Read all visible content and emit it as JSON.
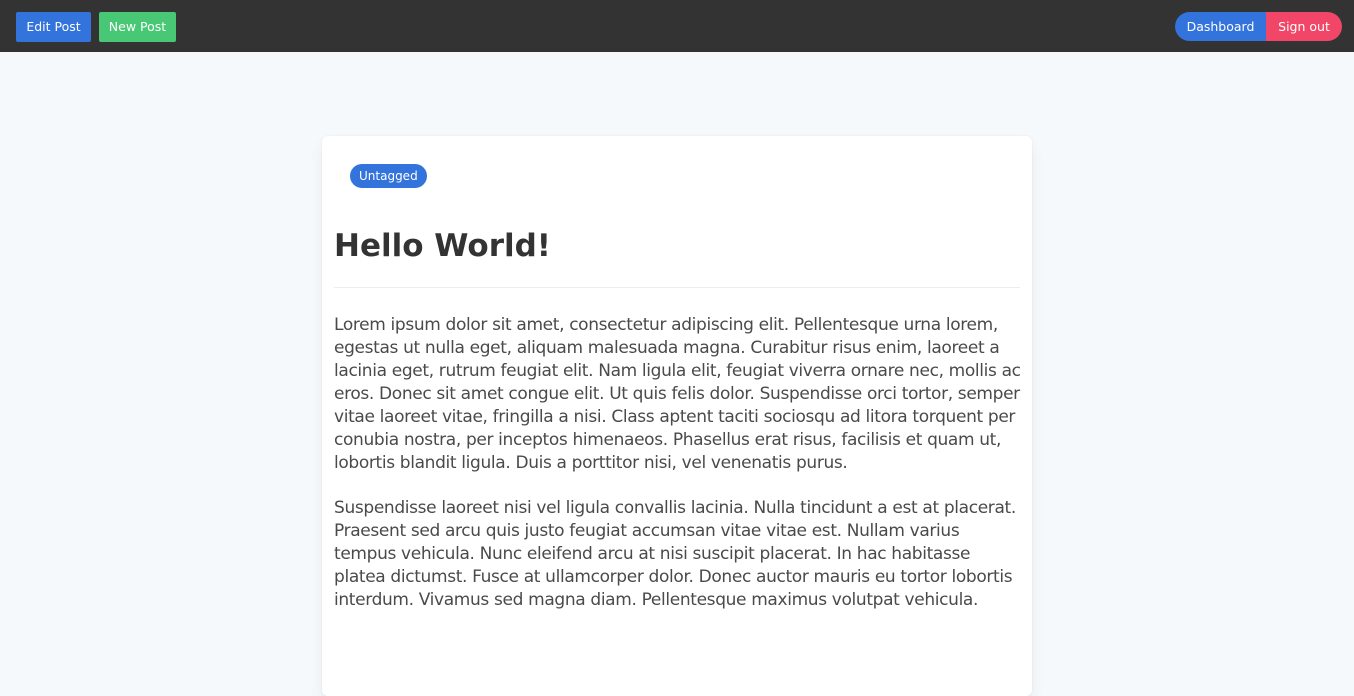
{
  "toolbar": {
    "edit_label": "Edit Post",
    "new_label": "New Post",
    "dashboard_label": "Dashboard",
    "signout_label": "Sign out"
  },
  "post": {
    "tag": "Untagged",
    "title": "Hello World!",
    "paragraphs": [
      "Lorem ipsum dolor sit amet, consectetur adipiscing elit. Pellentesque urna lorem, egestas ut nulla eget, aliquam malesuada magna. Curabitur risus enim, laoreet a lacinia eget, rutrum feugiat elit. Nam ligula elit, feugiat viverra ornare nec, mollis ac eros. Donec sit amet congue elit. Ut quis felis dolor. Suspendisse orci tortor, semper vitae laoreet vitae, fringilla a nisi. Class aptent taciti sociosqu ad litora torquent per conubia nostra, per inceptos himenaeos. Phasellus erat risus, facilisis et quam ut, lobortis blandit ligula. Duis a porttitor nisi, vel venenatis purus.",
      "Suspendisse laoreet nisi vel ligula convallis lacinia. Nulla tincidunt a est at placerat. Praesent sed arcu quis justo feugiat accumsan vitae vitae est. Nullam varius tempus vehicula. Nunc eleifend arcu at nisi suscipit placerat. In hac habitasse platea dictumst. Fusce at ullamcorper dolor. Donec auctor mauris eu tortor lobortis interdum. Vivamus sed magna diam. Pellentesque maximus volutpat vehicula."
    ]
  },
  "colors": {
    "primary": "#3273dc",
    "success": "#48c774",
    "danger": "#f14668",
    "navbar": "#333333",
    "page_background": "#f6f9fc"
  }
}
